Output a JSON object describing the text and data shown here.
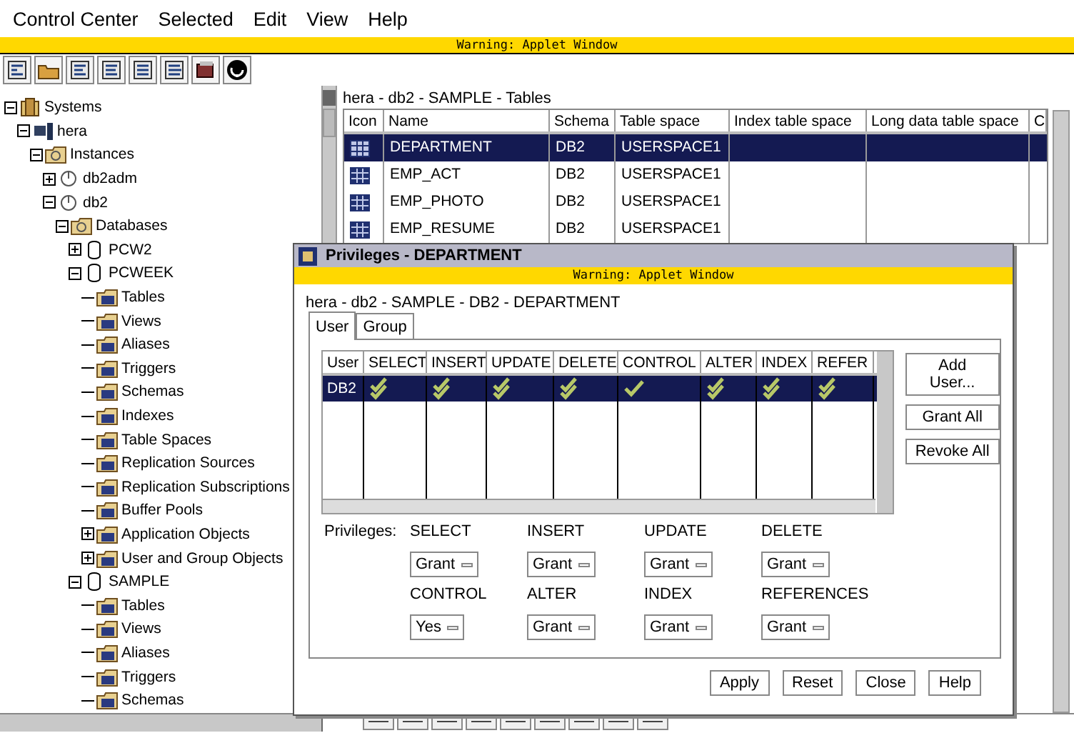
{
  "menu": [
    "Control Center",
    "Selected",
    "Edit",
    "View",
    "Help"
  ],
  "warning": "Warning: Applet Window",
  "tree": [
    {
      "label": "Systems",
      "kind": "system",
      "expanded": true,
      "children": [
        {
          "label": "hera",
          "kind": "host",
          "expanded": true,
          "children": [
            {
              "label": "Instances",
              "kind": "group",
              "expanded": true,
              "children": [
                {
                  "label": "db2adm",
                  "kind": "instance",
                  "expanded": false
                },
                {
                  "label": "db2",
                  "kind": "instance",
                  "expanded": true,
                  "children": [
                    {
                      "label": "Databases",
                      "kind": "group",
                      "expanded": true,
                      "children": [
                        {
                          "label": "PCW2",
                          "kind": "database",
                          "expanded": false
                        },
                        {
                          "label": "PCWEEK",
                          "kind": "database",
                          "expanded": true,
                          "children": [
                            {
                              "label": "Tables",
                              "kind": "folder"
                            },
                            {
                              "label": "Views",
                              "kind": "folder"
                            },
                            {
                              "label": "Aliases",
                              "kind": "folder"
                            },
                            {
                              "label": "Triggers",
                              "kind": "folder"
                            },
                            {
                              "label": "Schemas",
                              "kind": "folder"
                            },
                            {
                              "label": "Indexes",
                              "kind": "folder"
                            },
                            {
                              "label": "Table Spaces",
                              "kind": "folder"
                            },
                            {
                              "label": "Replication Sources",
                              "kind": "folder"
                            },
                            {
                              "label": "Replication Subscriptions",
                              "kind": "folder"
                            },
                            {
                              "label": "Buffer Pools",
                              "kind": "folder"
                            },
                            {
                              "label": "Application Objects",
                              "kind": "folder",
                              "expanded": false
                            },
                            {
                              "label": "User and Group Objects",
                              "kind": "folder",
                              "expanded": false
                            }
                          ]
                        },
                        {
                          "label": "SAMPLE",
                          "kind": "database",
                          "expanded": true,
                          "children": [
                            {
                              "label": "Tables",
                              "kind": "folder"
                            },
                            {
                              "label": "Views",
                              "kind": "folder"
                            },
                            {
                              "label": "Aliases",
                              "kind": "folder"
                            },
                            {
                              "label": "Triggers",
                              "kind": "folder"
                            },
                            {
                              "label": "Schemas",
                              "kind": "folder"
                            }
                          ]
                        }
                      ]
                    }
                  ]
                }
              ]
            }
          ]
        }
      ]
    }
  ],
  "contents": {
    "path": "hera - db2 - SAMPLE - Tables",
    "columns": [
      "Icon",
      "Name",
      "Schema",
      "Table space",
      "Index table space",
      "Long data table space",
      "C"
    ],
    "rows": [
      {
        "name": "DEPARTMENT",
        "schema": "DB2",
        "table_space": "USERSPACE1",
        "selected": true
      },
      {
        "name": "EMP_ACT",
        "schema": "DB2",
        "table_space": "USERSPACE1",
        "selected": false
      },
      {
        "name": "EMP_PHOTO",
        "schema": "DB2",
        "table_space": "USERSPACE1",
        "selected": false
      },
      {
        "name": "EMP_RESUME",
        "schema": "DB2",
        "table_space": "USERSPACE1",
        "selected": false
      }
    ]
  },
  "dialog": {
    "title": "Privileges - DEPARTMENT",
    "warning": "Warning: Applet Window",
    "path": "hera - db2 - SAMPLE - DB2 - DEPARTMENT",
    "tabs": [
      {
        "label": "User",
        "selected": true
      },
      {
        "label": "Group",
        "selected": false
      }
    ],
    "columns": [
      "User",
      "SELECT",
      "INSERT",
      "UPDATE",
      "DELETE",
      "CONTROL",
      "ALTER",
      "INDEX",
      "REFER"
    ],
    "rows": [
      {
        "user": "DB2",
        "selected": true,
        "marks": [
          {
            "kind": "double"
          },
          {
            "kind": "double"
          },
          {
            "kind": "double"
          },
          {
            "kind": "double"
          },
          {
            "kind": "single"
          },
          {
            "kind": "double"
          },
          {
            "kind": "double"
          },
          {
            "kind": "double"
          }
        ]
      }
    ],
    "side_buttons": [
      "Add User...",
      "Grant All",
      "Revoke All"
    ],
    "privileges_label": "Privileges:",
    "privileges": [
      {
        "label": "SELECT",
        "value": "Grant"
      },
      {
        "label": "INSERT",
        "value": "Grant"
      },
      {
        "label": "UPDATE",
        "value": "Grant"
      },
      {
        "label": "DELETE",
        "value": "Grant"
      },
      {
        "label": "CONTROL",
        "value": "Yes"
      },
      {
        "label": "ALTER",
        "value": "Grant"
      },
      {
        "label": "INDEX",
        "value": "Grant"
      },
      {
        "label": "REFERENCES",
        "value": "Grant"
      }
    ],
    "buttons": [
      "Apply",
      "Reset",
      "Close",
      "Help"
    ]
  }
}
